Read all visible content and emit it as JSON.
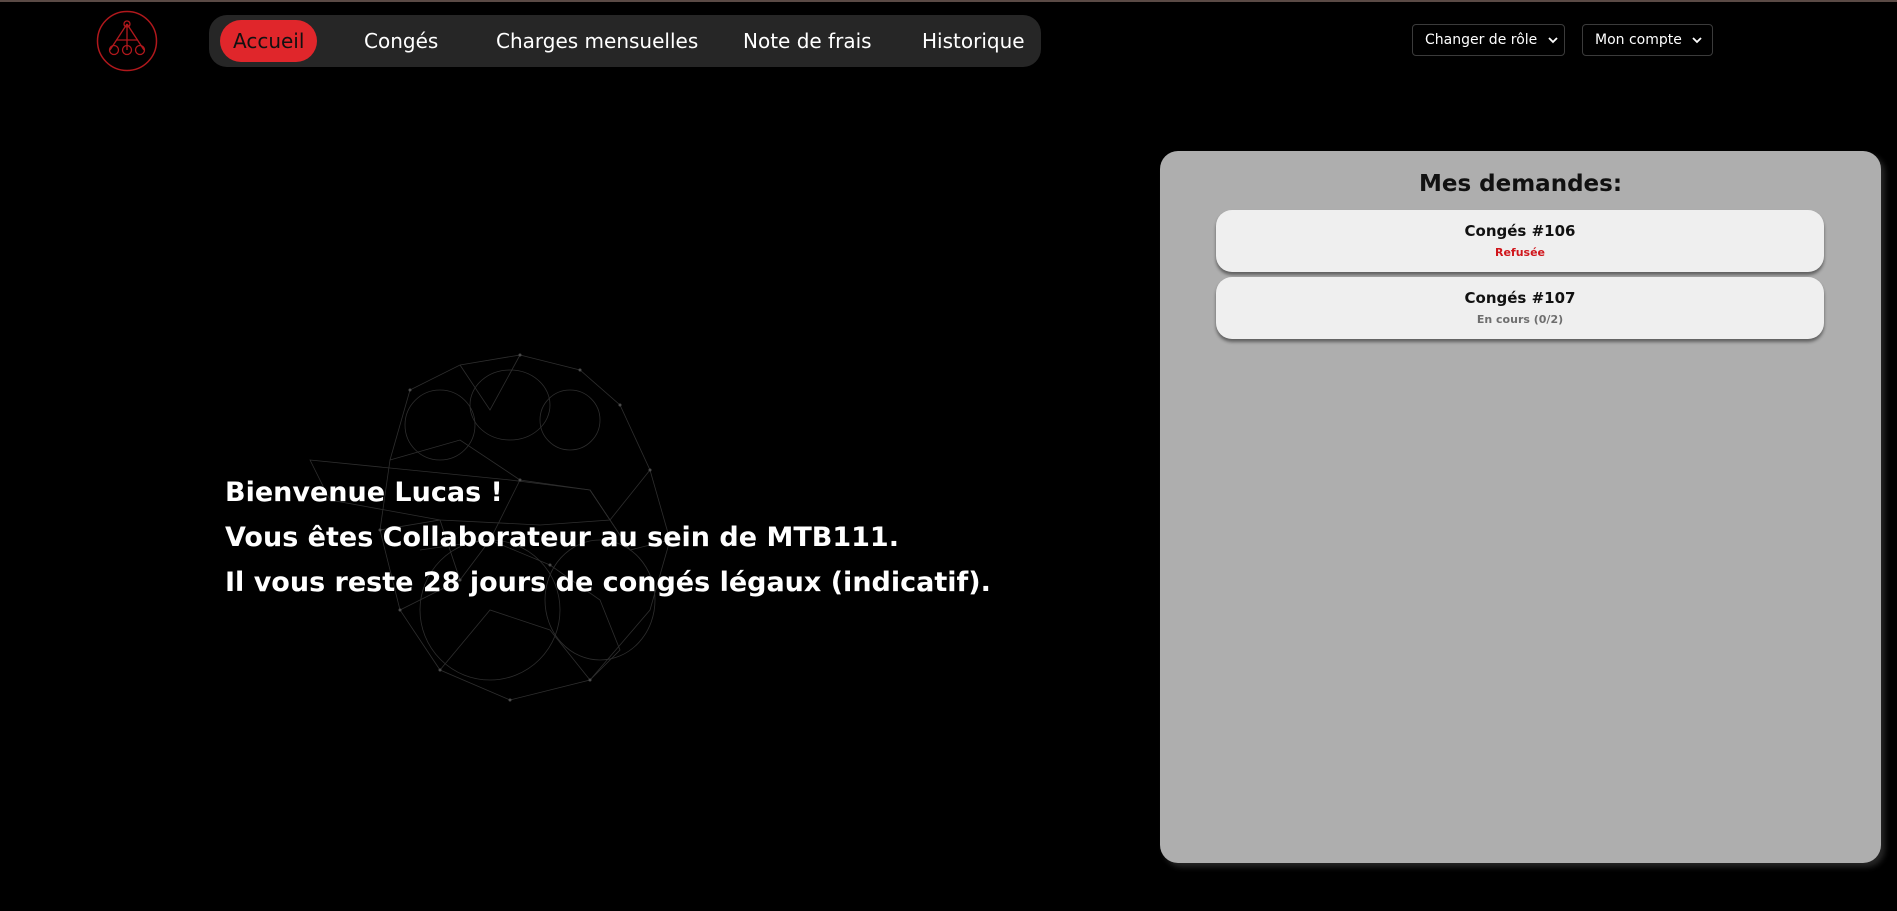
{
  "nav": {
    "items": [
      {
        "label": "Accueil",
        "active": true
      },
      {
        "label": "Congés"
      },
      {
        "label": "Charges mensuelles"
      },
      {
        "label": "Note de frais"
      },
      {
        "label": "Historique"
      }
    ]
  },
  "header": {
    "role_button": "Changer de rôle",
    "account_button": "Mon compte"
  },
  "welcome": {
    "line1": "Bienvenue Lucas !",
    "line2": "Vous êtes Collaborateur au sein de MTB111.",
    "line3": "Il vous reste 28 jours de congés légaux (indicatif)."
  },
  "requests_panel": {
    "title": "Mes demandes:",
    "items": [
      {
        "title": "Congés #106",
        "status": "Refusée",
        "status_color": "#d0151b"
      },
      {
        "title": "Congés #107",
        "status": "En cours (0/2)",
        "status_color": "#6e6e6e"
      }
    ]
  },
  "colors": {
    "accent": "#e0262b",
    "background": "#000000",
    "nav_bar": "#262626",
    "panel": "#aeaeae"
  }
}
